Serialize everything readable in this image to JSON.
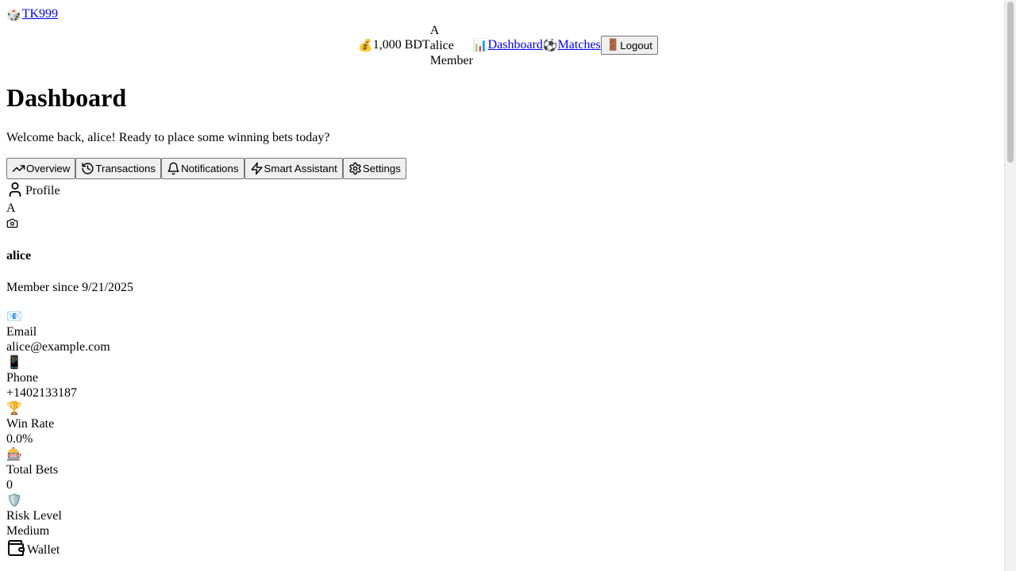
{
  "brand": {
    "icon": "dice-icon",
    "name": "TK999"
  },
  "header": {
    "balance_icon": "money-bag-icon",
    "balance": "1,000 BDT",
    "user": {
      "avatar_initial": "A",
      "name": "alice",
      "role": "Member"
    },
    "nav": [
      {
        "icon": "bar-chart-icon",
        "label": "Dashboard"
      },
      {
        "icon": "soccer-ball-icon",
        "label": "Matches"
      }
    ],
    "logout_icon": "door-icon",
    "logout_label": "Logout"
  },
  "page": {
    "title": "Dashboard",
    "welcome": "Welcome back, alice! Ready to place some winning bets today?"
  },
  "tabs": [
    {
      "icon": "trending-up-icon",
      "label": "Overview"
    },
    {
      "icon": "history-icon",
      "label": "Transactions"
    },
    {
      "icon": "bell-icon",
      "label": "Notifications"
    },
    {
      "icon": "lightning-icon",
      "label": "Smart Assistant"
    },
    {
      "icon": "gear-icon",
      "label": "Settings"
    }
  ],
  "profile": {
    "title": "Profile",
    "avatar_initial": "A",
    "username": "alice",
    "member_since": "Member since 9/21/2025",
    "stats": [
      {
        "icon": "envelope-icon",
        "label": "Email",
        "value": "alice@example.com"
      },
      {
        "icon": "mobile-phone-icon",
        "label": "Phone",
        "value": "+1402133187"
      },
      {
        "icon": "trophy-icon",
        "label": "Win Rate",
        "value": "0.0%"
      },
      {
        "icon": "slot-machine-icon",
        "label": "Total Bets",
        "value": "0"
      },
      {
        "icon": "shield-icon",
        "label": "Risk Level",
        "value": "Medium"
      }
    ]
  },
  "wallet": {
    "title": "Wallet"
  }
}
